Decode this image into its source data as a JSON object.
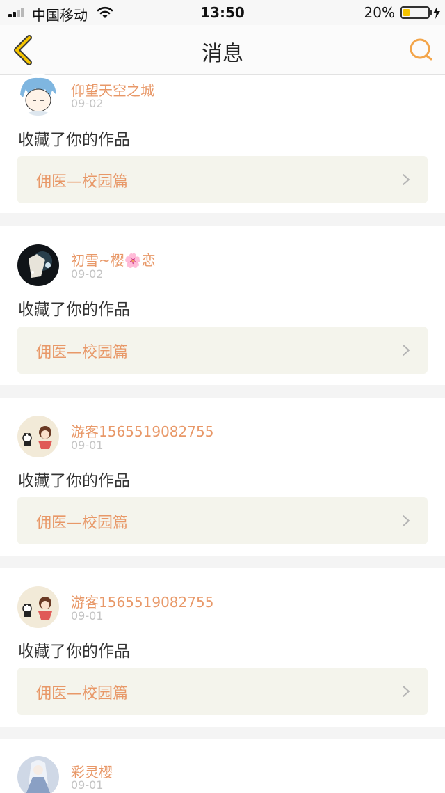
{
  "status_bar": {
    "carrier": "中国移动",
    "time": "13:50",
    "battery_percent": "20%",
    "battery_level": 0.2,
    "icons": [
      "signal-icon",
      "wifi-icon",
      "battery-icon",
      "charging-bolt-icon"
    ]
  },
  "nav": {
    "title": "消息",
    "back_icon": "chevron-left-icon",
    "search_icon": "search-icon"
  },
  "colors": {
    "accent": "#e89868",
    "back_chevron": "#f5c400",
    "date_gray": "#c4c4c4",
    "work_box_bg": "#f4f4ec",
    "page_bg": "#f4f4f4"
  },
  "messages": [
    {
      "username": "仰望天空之城",
      "date": "09-02",
      "action": "收藏了你的作品",
      "work_title": "佣医—校园篇"
    },
    {
      "username": "初雪~樱🌸恋",
      "date": "09-02",
      "action": "收藏了你的作品",
      "work_title": "佣医—校园篇"
    },
    {
      "username": "游客1565519082755",
      "date": "09-01",
      "action": "收藏了你的作品",
      "work_title": "佣医—校园篇"
    },
    {
      "username": "游客1565519082755",
      "date": "09-01",
      "action": "收藏了你的作品",
      "work_title": "佣医—校园篇"
    },
    {
      "username": "彩灵樱",
      "date": "09-01"
    }
  ]
}
